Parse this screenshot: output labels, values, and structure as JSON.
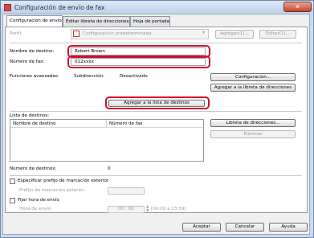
{
  "window": {
    "title": "Configuración de envío de fax",
    "close_label": "✕"
  },
  "tabs": [
    {
      "label": "Configuración de envío"
    },
    {
      "label": "Editar libreta de direcciones"
    },
    {
      "label": "Hoja de portada"
    }
  ],
  "profile": {
    "label": "Perfil:",
    "value": "Configuración predeterminada",
    "add_label": "Agregar(1)...",
    "edit_label": "Editar(1)..."
  },
  "recipient": {
    "name_label": "Nombre de destino:",
    "name_value": "Robert Brown",
    "fax_label": "Número de fax:",
    "fax_value": "012xxxx"
  },
  "advanced": {
    "label": "Funciones avanzadas:",
    "subaddress_label": "Subdirección:",
    "subaddress_value": "Desactivado",
    "config_button": "Configuración...",
    "add_to_book_button": "Agregar a la libreta de direcciones"
  },
  "add_to_list_button": "Agregar a la lista de destinos",
  "destinations": {
    "label": "Lista de destinos:",
    "columns": [
      "Nombre de destino",
      "Número de fax"
    ],
    "address_book_button": "Libreta de direcciones...",
    "delete_button": "Eliminar",
    "count_label": "Número de destinos:",
    "count_value": "0"
  },
  "prefix": {
    "checkbox_label": "Especificar prefijo de marcación exterior",
    "field_label": "Prefijo de marcación exterior:",
    "value": ""
  },
  "send_time": {
    "checkbox_label": "Fijar hora de envío",
    "field_label": "Hora de envío:",
    "value": "00 : 00",
    "range_hint": "[00:00 a 23:59]"
  },
  "footer": {
    "ok": "Aceptar",
    "cancel": "Cancelar",
    "help": "Ayuda"
  }
}
